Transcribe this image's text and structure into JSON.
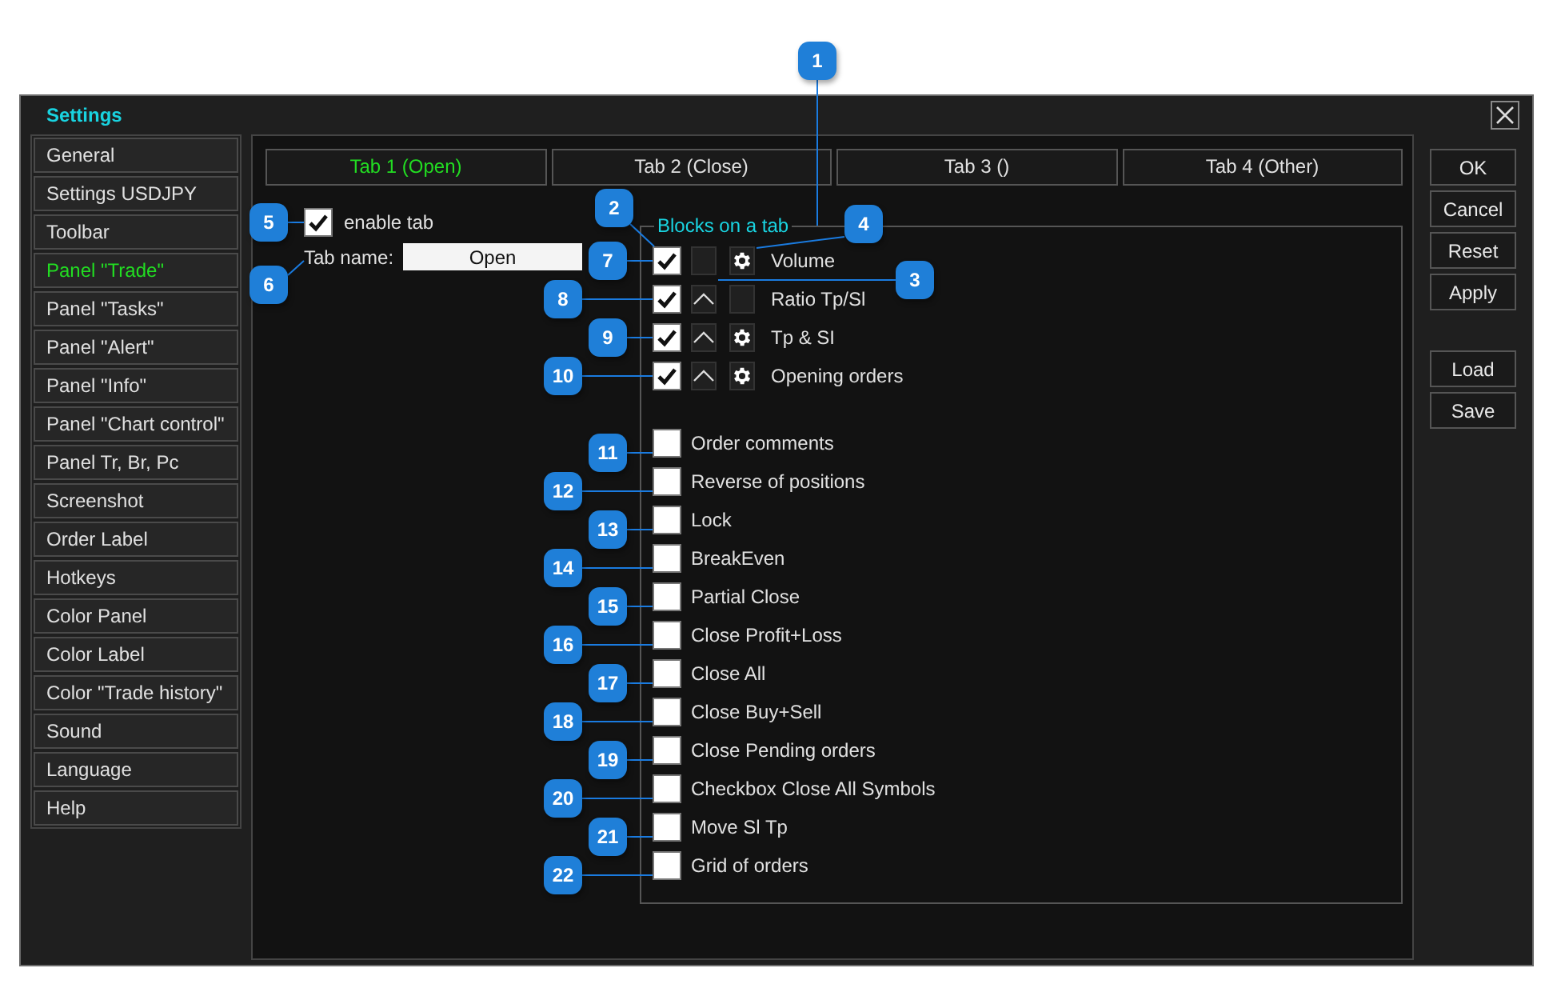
{
  "window": {
    "title": "Settings"
  },
  "sidebar": {
    "items": [
      {
        "label": "General",
        "selected": false
      },
      {
        "label": "Settings USDJPY",
        "selected": false
      },
      {
        "label": "Toolbar",
        "selected": false
      },
      {
        "label": "Panel \"Trade\"",
        "selected": true
      },
      {
        "label": "Panel \"Tasks\"",
        "selected": false
      },
      {
        "label": "Panel \"Alert\"",
        "selected": false
      },
      {
        "label": "Panel \"Info\"",
        "selected": false
      },
      {
        "label": "Panel \"Chart control\"",
        "selected": false
      },
      {
        "label": "Panel Tr, Br, Pc",
        "selected": false
      },
      {
        "label": "Screenshot",
        "selected": false
      },
      {
        "label": "Order Label",
        "selected": false
      },
      {
        "label": "Hotkeys",
        "selected": false
      },
      {
        "label": "Color Panel",
        "selected": false
      },
      {
        "label": "Color Label",
        "selected": false
      },
      {
        "label": "Color \"Trade history\"",
        "selected": false
      },
      {
        "label": "Sound",
        "selected": false
      },
      {
        "label": "Language",
        "selected": false
      },
      {
        "label": "Help",
        "selected": false
      }
    ]
  },
  "tabs": [
    {
      "label": "Tab 1 (Open)",
      "selected": true
    },
    {
      "label": "Tab 2 (Close)",
      "selected": false
    },
    {
      "label": "Tab 3 ()",
      "selected": false
    },
    {
      "label": "Tab 4 (Other)",
      "selected": false
    }
  ],
  "enable_tab": {
    "label": "enable tab",
    "checked": true
  },
  "tab_name": {
    "label": "Tab name:",
    "value": "Open"
  },
  "blocks": {
    "title": "Blocks on a tab",
    "block_rows": [
      {
        "label": "Volume",
        "checked": true,
        "move_up": false,
        "settings": true
      },
      {
        "label": "Ratio Tp/Sl",
        "checked": true,
        "move_up": true,
        "settings": false
      },
      {
        "label": "Tp & SI",
        "checked": true,
        "move_up": true,
        "settings": true
      },
      {
        "label": "Opening orders",
        "checked": true,
        "move_up": true,
        "settings": true
      }
    ],
    "option_rows": [
      {
        "label": "Order comments",
        "checked": false
      },
      {
        "label": "Reverse of positions",
        "checked": false
      },
      {
        "label": "Lock",
        "checked": false
      },
      {
        "label": "BreakEven",
        "checked": false
      },
      {
        "label": "Partial Close",
        "checked": false
      },
      {
        "label": "Close Profit+Loss",
        "checked": false
      },
      {
        "label": "Close All",
        "checked": false
      },
      {
        "label": "Close Buy+Sell",
        "checked": false
      },
      {
        "label": "Close Pending orders",
        "checked": false
      },
      {
        "label": "Checkbox Close All Symbols",
        "checked": false
      },
      {
        "label": "Move Sl Tp",
        "checked": false
      },
      {
        "label": "Grid of orders",
        "checked": false
      }
    ]
  },
  "buttons": {
    "top": [
      "OK",
      "Cancel",
      "Reset",
      "Apply"
    ],
    "bottom": [
      "Load",
      "Save"
    ]
  },
  "callouts": [
    "1",
    "2",
    "3",
    "4",
    "5",
    "6",
    "7",
    "8",
    "9",
    "10",
    "11",
    "12",
    "13",
    "14",
    "15",
    "16",
    "17",
    "18",
    "19",
    "20",
    "21",
    "22"
  ]
}
